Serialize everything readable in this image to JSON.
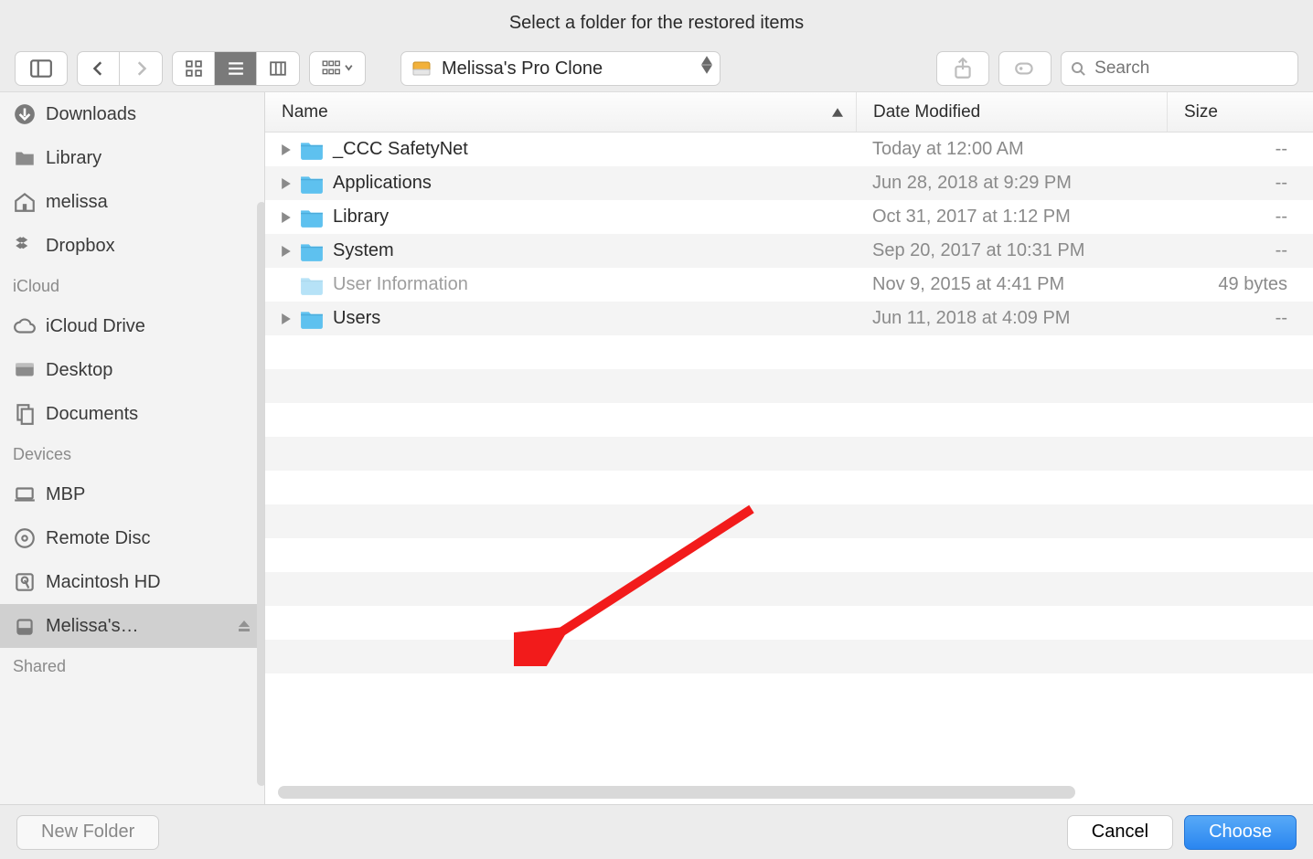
{
  "title": "Select a folder for the restored items",
  "location_select": {
    "label": "Melissa's Pro Clone"
  },
  "search": {
    "placeholder": "Search"
  },
  "columns": {
    "name": "Name",
    "date": "Date Modified",
    "size": "Size"
  },
  "sidebar": {
    "favorites_tail": [
      {
        "name": "Downloads",
        "icon": "downloads"
      },
      {
        "name": "Library",
        "icon": "folder-gray"
      },
      {
        "name": "melissa",
        "icon": "home"
      },
      {
        "name": "Dropbox",
        "icon": "dropbox"
      }
    ],
    "icloud_heading": "iCloud",
    "icloud": [
      {
        "name": "iCloud Drive",
        "icon": "cloud"
      },
      {
        "name": "Desktop",
        "icon": "desktop-bar"
      },
      {
        "name": "Documents",
        "icon": "documents"
      }
    ],
    "devices_heading": "Devices",
    "devices": [
      {
        "name": "MBP",
        "icon": "laptop",
        "eject": false
      },
      {
        "name": "Remote Disc",
        "icon": "disc",
        "eject": false
      },
      {
        "name": "Macintosh HD",
        "icon": "hdd",
        "eject": false
      },
      {
        "name": "Melissa's…",
        "icon": "external",
        "eject": true,
        "selected": true
      }
    ],
    "shared_heading": "Shared"
  },
  "rows": [
    {
      "name": "_CCC SafetyNet",
      "date": "Today at 12:00 AM",
      "size": "--",
      "expandable": true,
      "disabled": false
    },
    {
      "name": "Applications",
      "date": "Jun 28, 2018 at 9:29 PM",
      "size": "--",
      "expandable": true,
      "disabled": false
    },
    {
      "name": "Library",
      "date": "Oct 31, 2017 at 1:12 PM",
      "size": "--",
      "expandable": true,
      "disabled": false
    },
    {
      "name": "System",
      "date": "Sep 20, 2017 at 10:31 PM",
      "size": "--",
      "expandable": true,
      "disabled": false
    },
    {
      "name": "User Information",
      "date": "Nov 9, 2015 at 4:41 PM",
      "size": "49 bytes",
      "expandable": false,
      "disabled": true
    },
    {
      "name": "Users",
      "date": "Jun 11, 2018 at 4:09 PM",
      "size": "--",
      "expandable": true,
      "disabled": false
    }
  ],
  "empty_rows_count": 11,
  "footer": {
    "new_folder": "New Folder",
    "cancel": "Cancel",
    "choose": "Choose"
  }
}
